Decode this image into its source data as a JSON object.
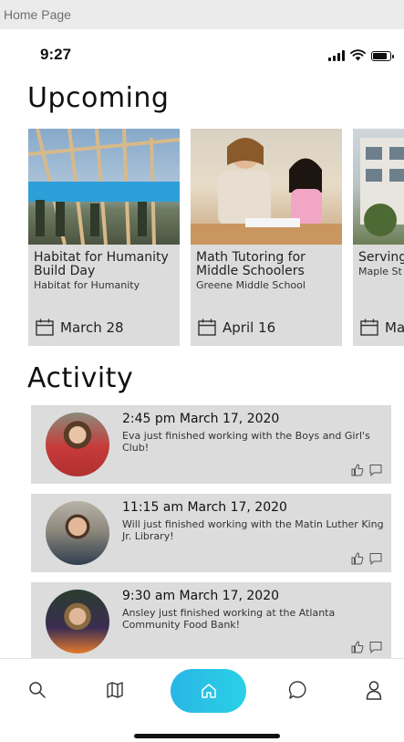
{
  "frame": {
    "label": "Home Page"
  },
  "status_bar": {
    "time": "9:27",
    "battery_level": 0.85
  },
  "upcoming": {
    "title": "Upcoming",
    "events": [
      {
        "title": "Habitat for Humanity Build Day",
        "org": "Habitat for Humanity",
        "date": "March 28"
      },
      {
        "title": "Math Tutoring for Middle Schoolers",
        "org": "Greene Middle School",
        "date": "April 16"
      },
      {
        "title": "Serving Homeless",
        "org": "Maple St",
        "date": "Ma"
      }
    ]
  },
  "activity": {
    "title": "Activity",
    "items": [
      {
        "time": "2:45 pm  March 17, 2020",
        "text": "Eva just finished working with the Boys and Girl's Club!"
      },
      {
        "time": "11:15 am  March 17, 2020",
        "text": "Will just finished working with the Matin Luther King Jr. Library!"
      },
      {
        "time": "9:30 am  March 17, 2020",
        "text": "Ansley just finished working at the Atlanta Community Food Bank!"
      }
    ]
  },
  "nav": {
    "items": [
      "search-icon",
      "map-icon",
      "home-icon",
      "chat-icon",
      "profile-icon"
    ],
    "active": "home-icon",
    "accent": "#29b6e6"
  }
}
